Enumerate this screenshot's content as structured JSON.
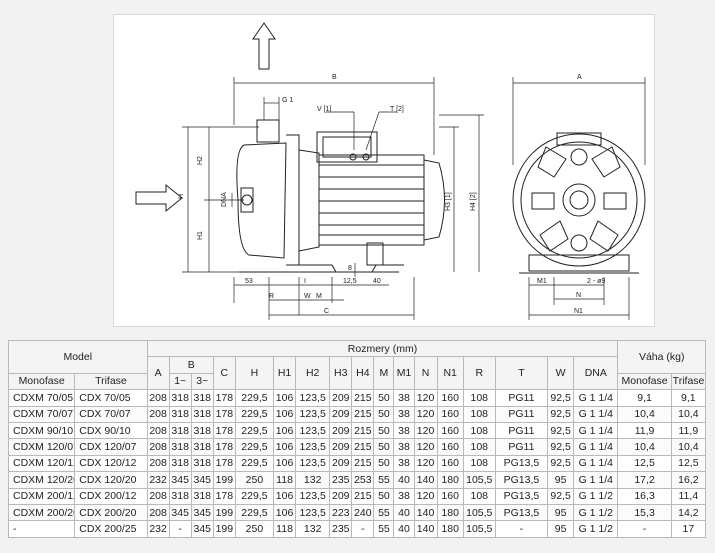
{
  "drawing": {
    "labels": {
      "B": "B",
      "A": "A",
      "G1": "G 1",
      "V1": "V [1]",
      "T2": "T [2]",
      "H2": "H2",
      "H": "H",
      "DNA": "DNA",
      "H1": "H1",
      "H3": "H3 [1]",
      "H4": "H4 [2]",
      "d53": "53",
      "R": "R",
      "I": "I",
      "W": "W",
      "M": "M",
      "C": "C",
      "d8": "8",
      "d12_5": "12,5",
      "d40": "40",
      "M1": "M1",
      "N": "N",
      "N1": "N1",
      "holes": "2 - ø9"
    }
  },
  "table": {
    "headers": {
      "model": "Model",
      "rozmery": "Rozmery (mm)",
      "vaha": "Váha (kg)",
      "monofase": "Monofase",
      "trifase": "Trifase",
      "B1": "1~",
      "B3": "3~",
      "cols": [
        "A",
        "B",
        "C",
        "H",
        "H1",
        "H2",
        "H3",
        "H4",
        "M",
        "M1",
        "N",
        "N1",
        "R",
        "T",
        "W",
        "DNA"
      ],
      "vaha_monofase": "Monofase",
      "vaha_trifase": "Trifase"
    },
    "rows": [
      [
        "CDXM 70/05",
        "CDX 70/05",
        "208",
        "318",
        "318",
        "178",
        "229,5",
        "106",
        "123,5",
        "209",
        "215",
        "50",
        "38",
        "120",
        "160",
        "108",
        "PG11",
        "92,5",
        "G 1 1/4",
        "9,1",
        "9,1"
      ],
      [
        "CDXM 70/07",
        "CDX 70/07",
        "208",
        "318",
        "318",
        "178",
        "229,5",
        "106",
        "123,5",
        "209",
        "215",
        "50",
        "38",
        "120",
        "160",
        "108",
        "PG11",
        "92,5",
        "G 1 1/4",
        "10,4",
        "10,4"
      ],
      [
        "CDXM 90/10",
        "CDX 90/10",
        "208",
        "318",
        "318",
        "178",
        "229,5",
        "106",
        "123,5",
        "209",
        "215",
        "50",
        "38",
        "120",
        "160",
        "108",
        "PG11",
        "92,5",
        "G 1 1/4",
        "11,9",
        "11,9"
      ],
      [
        "CDXM 120/07",
        "CDX 120/07",
        "208",
        "318",
        "318",
        "178",
        "229,5",
        "106",
        "123,5",
        "209",
        "215",
        "50",
        "38",
        "120",
        "160",
        "108",
        "PG11",
        "92,5",
        "G 1 1/4",
        "10,4",
        "10,4"
      ],
      [
        "CDXM 120/12",
        "CDX 120/12",
        "208",
        "318",
        "318",
        "178",
        "229,5",
        "106",
        "123,5",
        "209",
        "215",
        "50",
        "38",
        "120",
        "160",
        "108",
        "PG13,5",
        "92,5",
        "G 1 1/4",
        "12,5",
        "12,5"
      ],
      [
        "CDXM 120/20",
        "CDX 120/20",
        "232",
        "345",
        "345",
        "199",
        "250",
        "118",
        "132",
        "235",
        "253",
        "55",
        "40",
        "140",
        "180",
        "105,5",
        "PG13,5",
        "95",
        "G 1 1/4",
        "17,2",
        "16,2"
      ],
      [
        "CDXM 200/12",
        "CDX 200/12",
        "208",
        "318",
        "318",
        "178",
        "229,5",
        "106",
        "123,5",
        "209",
        "215",
        "50",
        "38",
        "120",
        "160",
        "108",
        "PG13,5",
        "92,5",
        "G 1 1/2",
        "16,3",
        "11,4"
      ],
      [
        "CDXM 200/20",
        "CDX 200/20",
        "208",
        "345",
        "345",
        "199",
        "229,5",
        "106",
        "123,5",
        "223",
        "240",
        "55",
        "40",
        "140",
        "180",
        "105,5",
        "PG13,5",
        "95",
        "G 1 1/2",
        "15,3",
        "14,2"
      ],
      [
        "-",
        "CDX 200/25",
        "232",
        "-",
        "345",
        "199",
        "250",
        "118",
        "132",
        "235",
        "-",
        "55",
        "40",
        "140",
        "180",
        "105,5",
        "-",
        "95",
        "G 1 1/2",
        "-",
        "17"
      ]
    ]
  }
}
